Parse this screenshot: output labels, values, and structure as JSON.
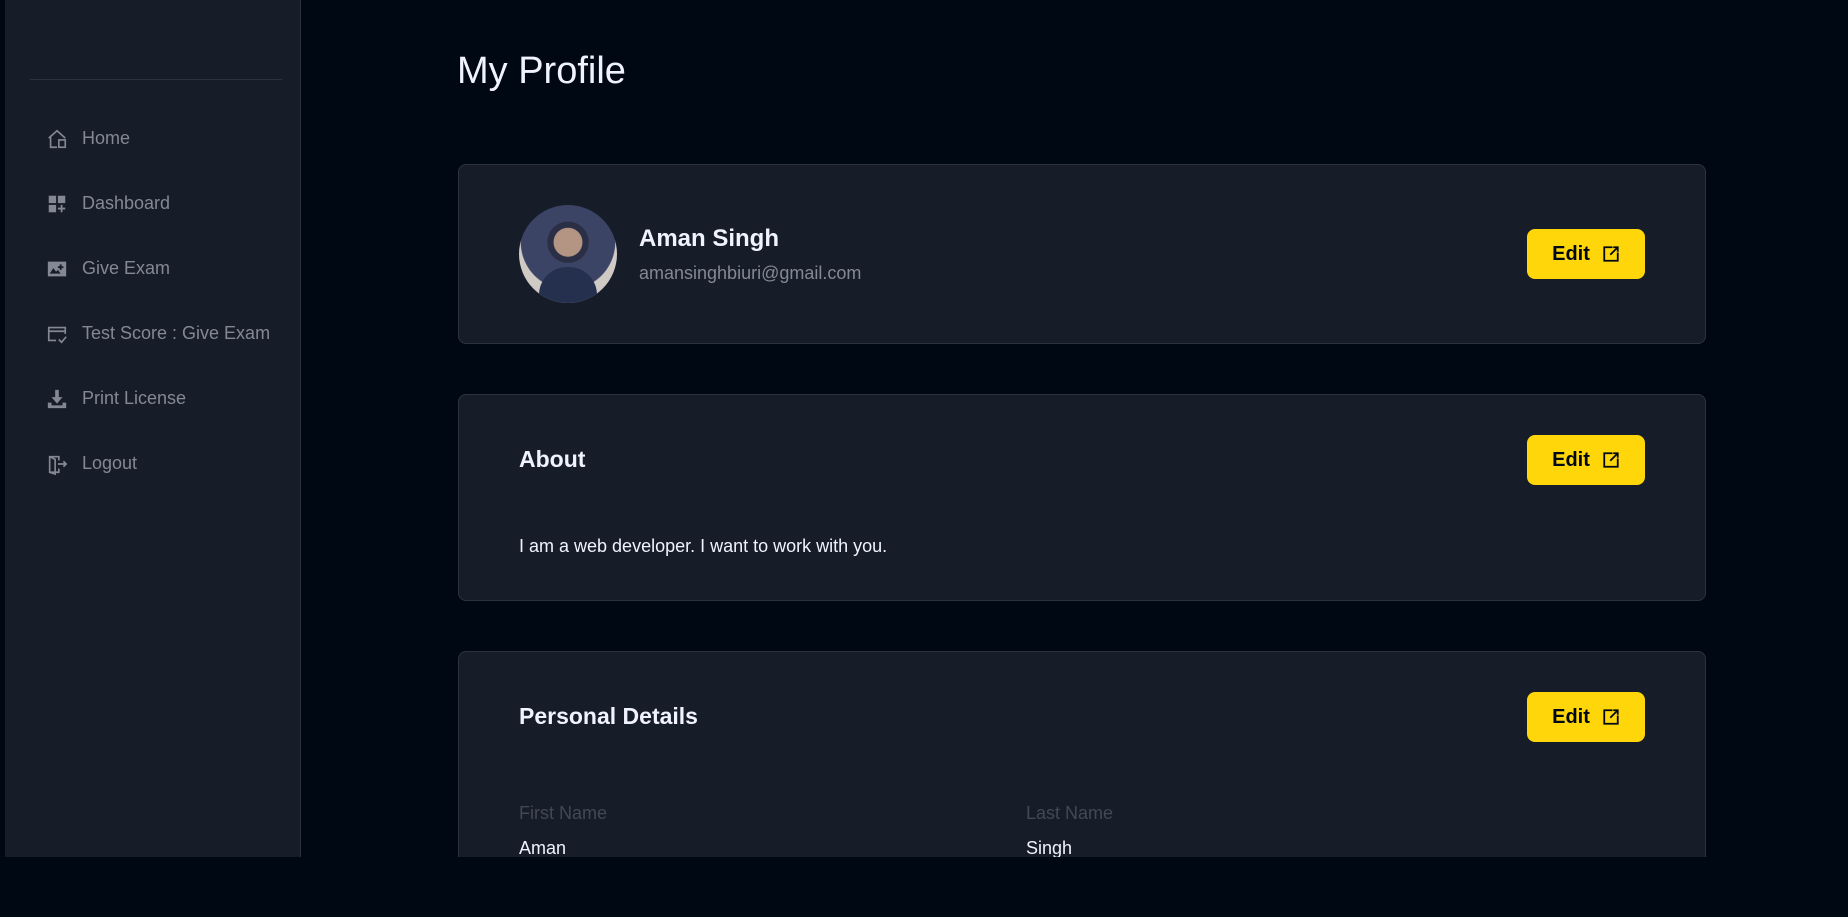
{
  "sidebar": {
    "items": [
      {
        "label": "Home",
        "icon": "home-icon"
      },
      {
        "label": "Dashboard",
        "icon": "dashboard-icon"
      },
      {
        "label": "Give Exam",
        "icon": "exam-icon"
      },
      {
        "label": "Test Score : Give Exam",
        "icon": "score-icon"
      },
      {
        "label": "Print License",
        "icon": "download-icon"
      },
      {
        "label": "Logout",
        "icon": "logout-icon"
      }
    ]
  },
  "page": {
    "title": "My Profile"
  },
  "profile": {
    "name": "Aman Singh",
    "email": "amansinghbiuri@gmail.com",
    "edit_label": "Edit"
  },
  "about": {
    "title": "About",
    "text": "I am a web developer. I want to work with you.",
    "edit_label": "Edit"
  },
  "personal": {
    "title": "Personal Details",
    "edit_label": "Edit",
    "fields": [
      {
        "label": "First Name",
        "value": "Aman"
      },
      {
        "label": "Last Name",
        "value": "Singh"
      }
    ]
  },
  "colors": {
    "accent": "#FFD60A",
    "background": "#000814",
    "card": "#161D29",
    "border": "#2C333F",
    "muted": "#838894"
  }
}
